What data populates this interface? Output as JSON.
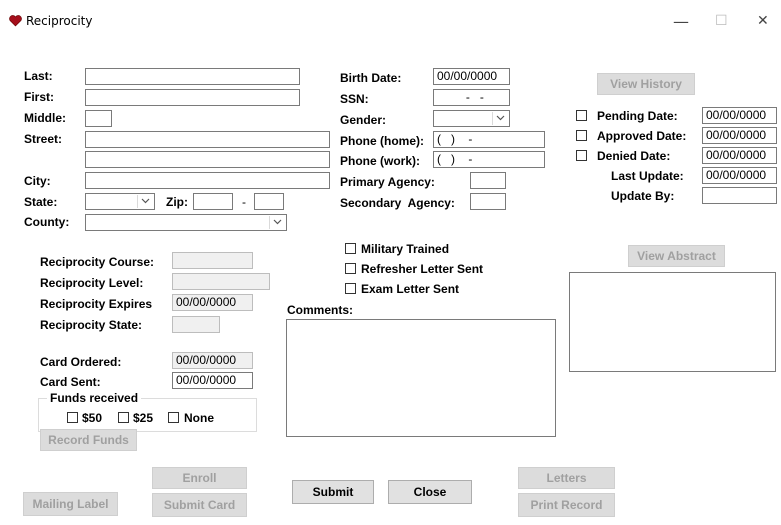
{
  "window": {
    "title": "Reciprocity",
    "minimize": "—",
    "maximize": "☐",
    "close": "✕"
  },
  "person": {
    "last_label": "Last:",
    "first_label": "First:",
    "middle_label": "Middle:",
    "street_label": "Street:",
    "city_label": "City:",
    "state_label": "State:",
    "zip_label": "Zip:",
    "zip_sep": "-",
    "county_label": "County:",
    "last": "",
    "first": "",
    "middle": "",
    "street1": "",
    "street2": "",
    "city": "",
    "state": "",
    "zip": "",
    "zip4": "",
    "county": ""
  },
  "details": {
    "birth_label": "Birth Date:",
    "birth": "00/00/0000",
    "ssn_label": "SSN:",
    "ssn": "  -   -",
    "gender_label": "Gender:",
    "gender": "",
    "phone_home_label": "Phone (home):",
    "phone_home": "(   )    -",
    "phone_work_label": "Phone (work):",
    "phone_work": "(   )    -",
    "primary_label": "Primary Agency:",
    "primary": "",
    "secondary_label": "Secondary  Agency:",
    "secondary": ""
  },
  "status": {
    "view_history": "View History",
    "pending_label": "Pending Date:",
    "pending": "00/00/0000",
    "approved_label": "Approved Date:",
    "approved": "00/00/0000",
    "denied_label": "Denied Date:",
    "denied": "00/00/0000",
    "last_update_label": "Last Update:",
    "last_update": "00/00/0000",
    "update_by_label": "Update By:",
    "update_by": ""
  },
  "reciprocity": {
    "course_label": "Reciprocity Course:",
    "course": "",
    "level_label": "Reciprocity Level:",
    "level": "",
    "expires_label": "Reciprocity Expires",
    "expires": "00/00/0000",
    "state_label": "Reciprocity State:",
    "state": ""
  },
  "card": {
    "ordered_label": "Card Ordered:",
    "ordered": "00/00/0000",
    "sent_label": "Card Sent:",
    "sent": "00/00/0000"
  },
  "funds": {
    "legend": "Funds received",
    "opt50": "$50",
    "opt25": "$25",
    "none": "None",
    "record_button": "Record Funds"
  },
  "flags": {
    "military": "Military Trained",
    "refresher": "Refresher Letter Sent",
    "exam": "Exam Letter Sent"
  },
  "comments": {
    "label": "Comments:",
    "value": ""
  },
  "abstract": {
    "button": "View Abstract"
  },
  "buttons": {
    "mailing_label": "Mailing Label",
    "enroll": "Enroll",
    "submit_card": "Submit Card",
    "submit": "Submit",
    "close": "Close",
    "letters": "Letters",
    "print_record": "Print Record"
  }
}
